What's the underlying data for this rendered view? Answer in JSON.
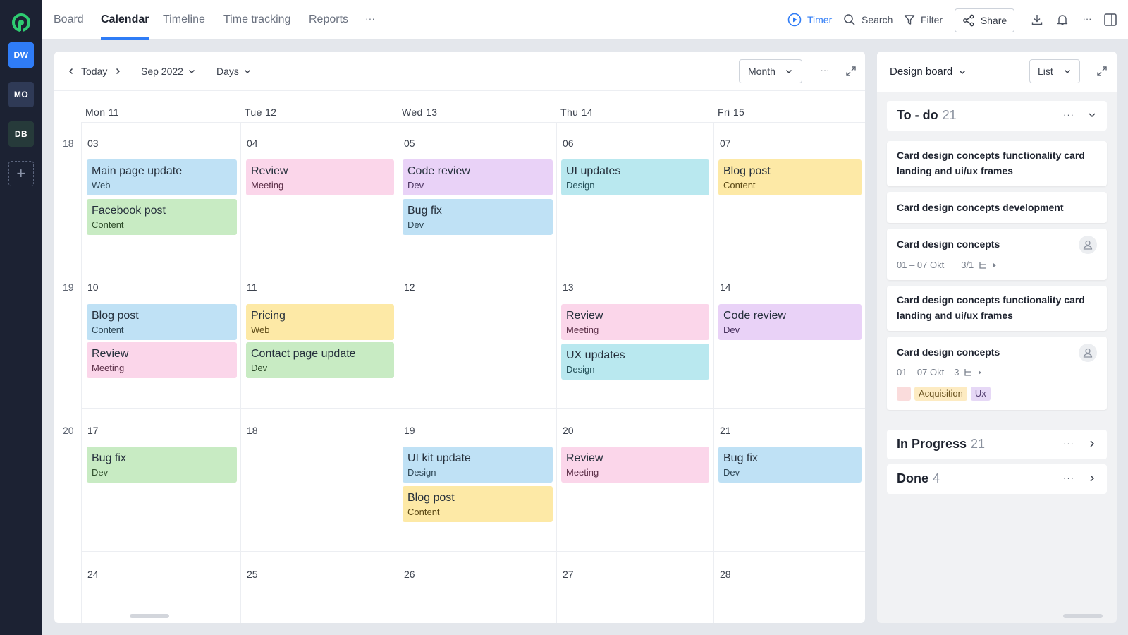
{
  "rail": {
    "workspaces": [
      {
        "initials": "DW",
        "active": true
      },
      {
        "initials": "MO"
      },
      {
        "initials": "DB"
      }
    ],
    "add_label": "+"
  },
  "topbar": {
    "tabs": [
      "Board",
      "Calendar",
      "Timeline",
      "Time tracking",
      "Reports"
    ],
    "active_tab": "Calendar",
    "more_label": "···",
    "timer_label": "Timer",
    "search_label": "Search",
    "filter_label": "Filter",
    "share_label": "Share"
  },
  "calendar": {
    "today_label": "Today",
    "period_label": "Sep 2022",
    "unit_label": "Days",
    "view_label": "Month",
    "day_headers": [
      "Mon 11",
      "Tue 12",
      "Wed 13",
      "Thu 14",
      "Fri 15"
    ],
    "weeks": [
      {
        "week": "18",
        "dates": [
          "03",
          "04",
          "05",
          "06",
          "07"
        ]
      },
      {
        "week": "19",
        "dates": [
          "10",
          "11",
          "12",
          "13",
          "14"
        ]
      },
      {
        "week": "20",
        "dates": [
          "17",
          "18",
          "19",
          "20",
          "21"
        ]
      },
      {
        "week": "",
        "dates": [
          "24",
          "25",
          "26",
          "27",
          "28"
        ]
      }
    ],
    "events": [
      {
        "title": "Main page update",
        "tag": "Web",
        "color": "blue"
      },
      {
        "title": "Facebook post",
        "tag": "Content",
        "color": "green"
      },
      {
        "title": "Review",
        "tag": "Meeting",
        "color": "pink"
      },
      {
        "title": "Code review",
        "tag": "Dev",
        "color": "purple"
      },
      {
        "title": "Bug fix",
        "tag": "Dev",
        "color": "blue"
      },
      {
        "title": "UI updates",
        "tag": "Design",
        "color": "cyan"
      },
      {
        "title": "Blog post",
        "tag": "Content",
        "color": "yellow"
      },
      {
        "title": "Blog post",
        "tag": "Content",
        "color": "blue"
      },
      {
        "title": "Review",
        "tag": "Meeting",
        "color": "pink"
      },
      {
        "title": "Pricing",
        "tag": "Web",
        "color": "yellow"
      },
      {
        "title": "Contact page update",
        "tag": "Dev",
        "color": "green"
      },
      {
        "title": "Review",
        "tag": "Meeting",
        "color": "pink"
      },
      {
        "title": "UX updates",
        "tag": "Design",
        "color": "cyan"
      },
      {
        "title": "Code review",
        "tag": "Dev",
        "color": "purple"
      },
      {
        "title": "Bug fix",
        "tag": "Dev",
        "color": "green"
      },
      {
        "title": "UI kit update",
        "tag": "Design",
        "color": "blue"
      },
      {
        "title": "Blog post",
        "tag": "Content",
        "color": "yellow"
      },
      {
        "title": "Review",
        "tag": "Meeting",
        "color": "pink"
      },
      {
        "title": "Bug fix",
        "tag": "Dev",
        "color": "blue"
      }
    ]
  },
  "side": {
    "board_label": "Design board",
    "view_label": "List",
    "sections": [
      {
        "name": "To - do",
        "count": "21"
      },
      {
        "name": "In Progress",
        "count": "21"
      },
      {
        "name": "Done",
        "count": "4"
      }
    ],
    "cards": [
      {
        "title": "Card design concepts functionality card landing and ui/ux frames"
      },
      {
        "title": "Card design concepts development"
      },
      {
        "title": "Card design concepts",
        "dates": "01 – 07 Okt",
        "subtasks": "3/1"
      },
      {
        "title": "Card design concepts functionality card landing and ui/ux frames"
      },
      {
        "title": "Card design concepts",
        "dates": "01 – 07 Okt",
        "subtasks": "3",
        "tags": [
          "Acquisition",
          "Ux"
        ]
      }
    ]
  },
  "colors": {
    "accent": "#2f7cf6",
    "rail": "#1c2233",
    "event_blue": "#bfe1f5",
    "event_pink": "#fbd6ea",
    "event_purple": "#e9d2f7",
    "event_cyan": "#b9e8ef",
    "event_yellow": "#fde9a6",
    "event_green": "#c8ebc3"
  }
}
